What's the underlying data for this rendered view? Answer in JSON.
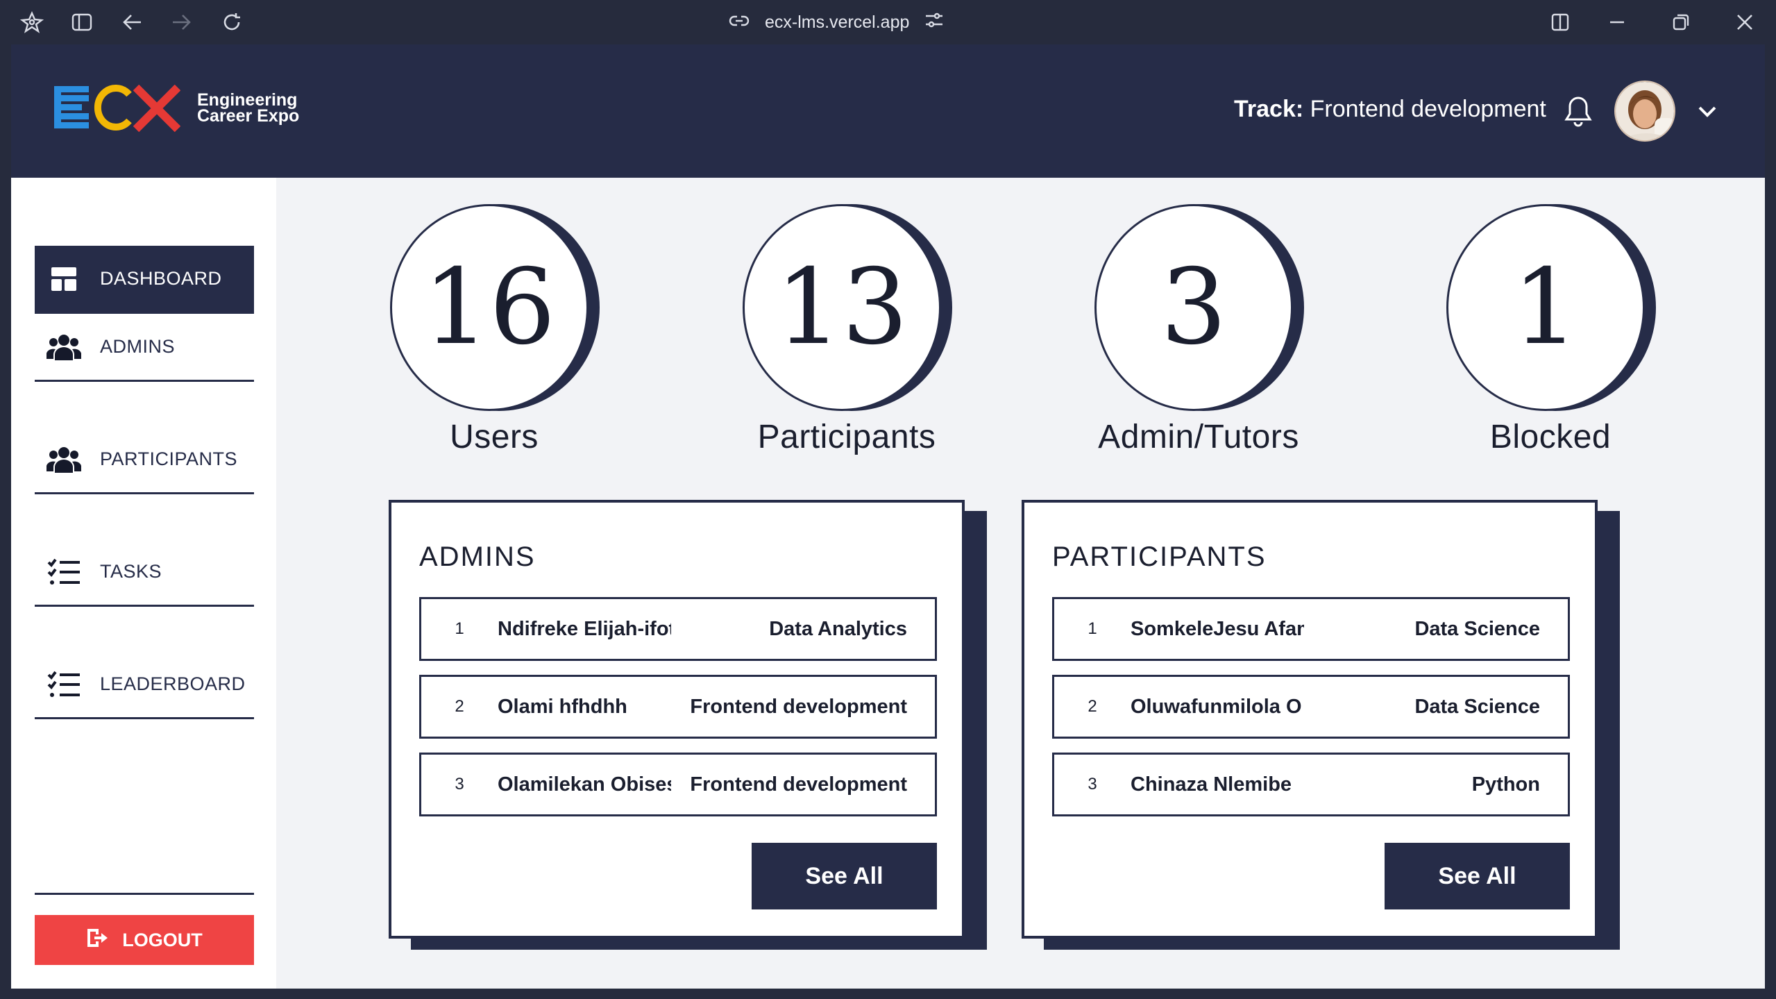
{
  "browser": {
    "url": "ecx-lms.vercel.app",
    "icons": [
      "app-icon",
      "sidebar-toggle-icon",
      "back-icon",
      "forward-icon",
      "reload-icon",
      "link-icon",
      "site-settings-icon",
      "split-view-icon",
      "minimize-icon",
      "restore-icon",
      "close-icon"
    ]
  },
  "header": {
    "logo_mark": "ECX",
    "logo_line1": "Engineering",
    "logo_line2": "Career Expo",
    "track_label": "Track:",
    "track_value": "Frontend development",
    "colors": {
      "navy": "#262c48",
      "blue": "#2b8fe0",
      "yellow": "#f2b705",
      "red": "#e53935"
    }
  },
  "sidebar": {
    "items": [
      {
        "label": "DASHBOARD",
        "icon": "dashboard-icon",
        "active": true
      },
      {
        "label": "ADMINS",
        "icon": "users-icon",
        "active": false
      },
      {
        "label": "PARTICIPANTS",
        "icon": "users-icon",
        "active": false
      },
      {
        "label": "TASKS",
        "icon": "checklist-icon",
        "active": false
      },
      {
        "label": "LEADERBOARD",
        "icon": "checklist-icon",
        "active": false
      }
    ],
    "logout_label": "LOGOUT",
    "logout_color": "#ef4444"
  },
  "stats": [
    {
      "value": "16",
      "label": "Users"
    },
    {
      "value": "13",
      "label": "Participants"
    },
    {
      "value": "3",
      "label": "Admin/Tutors"
    },
    {
      "value": "1",
      "label": "Blocked"
    }
  ],
  "admins_card": {
    "title": "ADMINS",
    "rows": [
      {
        "num": "1",
        "name": "Ndifreke Elijah-ifot",
        "track": "Data Analytics"
      },
      {
        "num": "2",
        "name": "Olami hfhdhh",
        "track": "Frontend development"
      },
      {
        "num": "3",
        "name": "Olamilekan Obisesan",
        "track": "Frontend development"
      }
    ],
    "button": "See All"
  },
  "participants_card": {
    "title": "PARTICIPANTS",
    "rows": [
      {
        "num": "1",
        "name": "SomkeleJesu Afam",
        "track": "Data Science"
      },
      {
        "num": "2",
        "name": "Oluwafunmilola O",
        "track": "Data Science"
      },
      {
        "num": "3",
        "name": "Chinaza Nlemibe",
        "track": "Python"
      }
    ],
    "button": "See All"
  }
}
